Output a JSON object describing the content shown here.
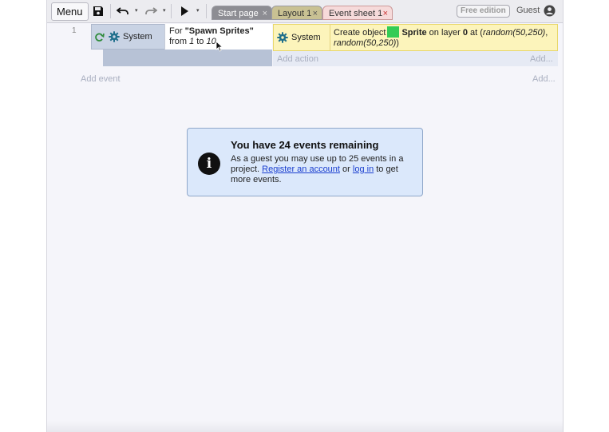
{
  "toolbar": {
    "menu_label": "Menu",
    "tabs": [
      {
        "label": "Start page",
        "close": "×"
      },
      {
        "label": "Layout 1",
        "close": "×"
      },
      {
        "label": "Event sheet 1",
        "close": "×"
      }
    ],
    "edition_badge": "Free edition",
    "user_label": "Guest"
  },
  "events": [
    {
      "number": "1",
      "condition": {
        "object": "System",
        "text_prefix": "For ",
        "text_name": "\"Spawn Sprites\"",
        "text_from": "from ",
        "text_start": "1",
        "text_to": " to ",
        "text_end": "10"
      },
      "action": {
        "object": "System",
        "text_prefix": "Create object",
        "object_name": "Sprite",
        "text_layer": " on layer ",
        "layer": "0",
        "text_at": " at (",
        "x_expr": "random(50,250)",
        "sep": ", ",
        "y_expr": "random(50,250)",
        "close": ")",
        "swatch_color": "#33cc55"
      }
    }
  ],
  "sheet": {
    "add_action": "Add action",
    "add_action_more": "Add...",
    "add_event": "Add event",
    "add_event_more": "Add..."
  },
  "notice": {
    "icon": "info-icon",
    "title": "You have 24 events remaining",
    "body_1": "As a guest you may use up to 25 events in a project. ",
    "link_register": "Register an account",
    "body_2": " or ",
    "link_login": "log in",
    "body_3": " to get more events."
  }
}
